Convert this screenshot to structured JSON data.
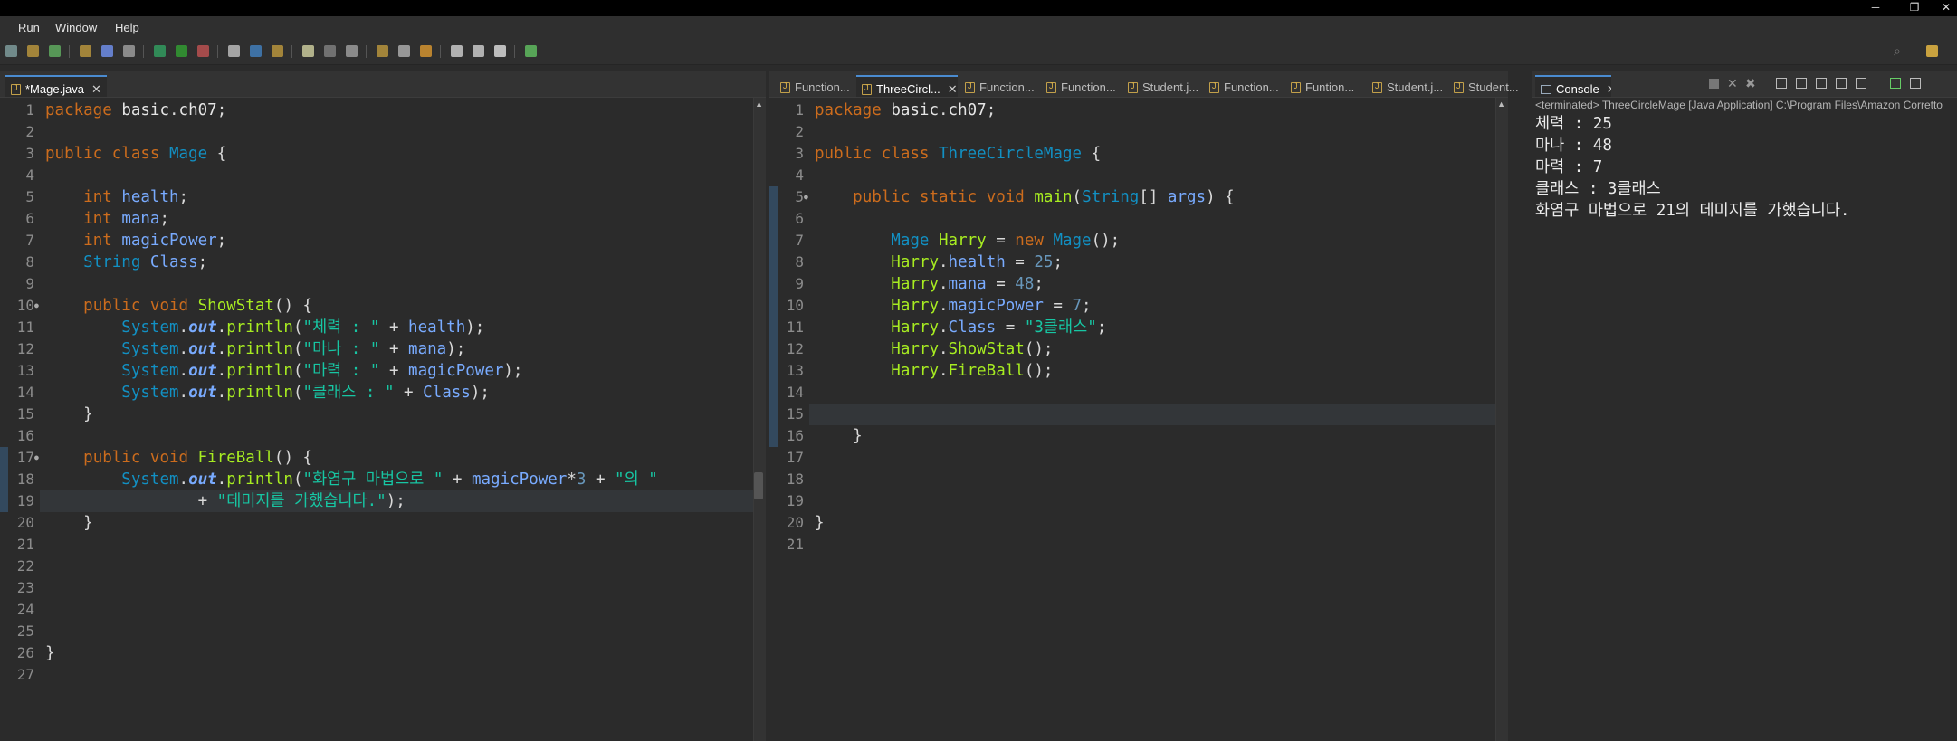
{
  "menu": {
    "items": [
      "Run",
      "Window",
      "Help"
    ]
  },
  "left_editor": {
    "tab": "*Mage.java",
    "lines": [
      "package basic.ch07;",
      "",
      "public class Mage {",
      "",
      "    int health;",
      "    int mana;",
      "    int magicPower;",
      "    String Class;",
      "",
      "    public void ShowStat() {",
      "        System.out.println(\"체력 : \" + health);",
      "        System.out.println(\"마나 : \" + mana);",
      "        System.out.println(\"마력 : \" + magicPower);",
      "        System.out.println(\"클래스 : \" + Class);",
      "    }",
      "",
      "    public void FireBall() {",
      "        System.out.println(\"화염구 마법으로 \" + magicPower*3 + \"의 \"",
      "                + \"데미지를 가했습니다.\");",
      "    }",
      "",
      "",
      "",
      "",
      "",
      "}",
      ""
    ]
  },
  "middle_editor": {
    "tabs": [
      "Function...",
      "ThreeCircl...",
      "Function...",
      "Function...",
      "Student.j...",
      "Function...",
      "Funtion...",
      "Student.j...",
      "Student..."
    ],
    "lines": [
      "package basic.ch07;",
      "",
      "public class ThreeCircleMage {",
      "",
      "    public static void main(String[] args) {",
      "",
      "        Mage Harry = new Mage();",
      "        Harry.health = 25;",
      "        Harry.mana = 48;",
      "        Harry.magicPower = 7;",
      "        Harry.Class = \"3클래스\";",
      "        Harry.ShowStat();",
      "        Harry.FireBall();",
      "",
      "",
      "    }",
      "",
      "",
      "",
      "}",
      ""
    ]
  },
  "console": {
    "tab": "Console",
    "status": "<terminated> ThreeCircleMage [Java Application] C:\\Program Files\\Amazon Corretto",
    "output": [
      "체력 : 25",
      "마나 : 48",
      "마력 : 7",
      "클래스 : 3클래스",
      "화염구 마법으로 21의 데미지를 가했습니다."
    ]
  },
  "colors": {
    "background": "#2b2b2b",
    "keyword": "#cc6c1d",
    "type": "#1290c3",
    "string": "#17c6a3",
    "method": "#a7ec21",
    "field": "#79abff"
  }
}
